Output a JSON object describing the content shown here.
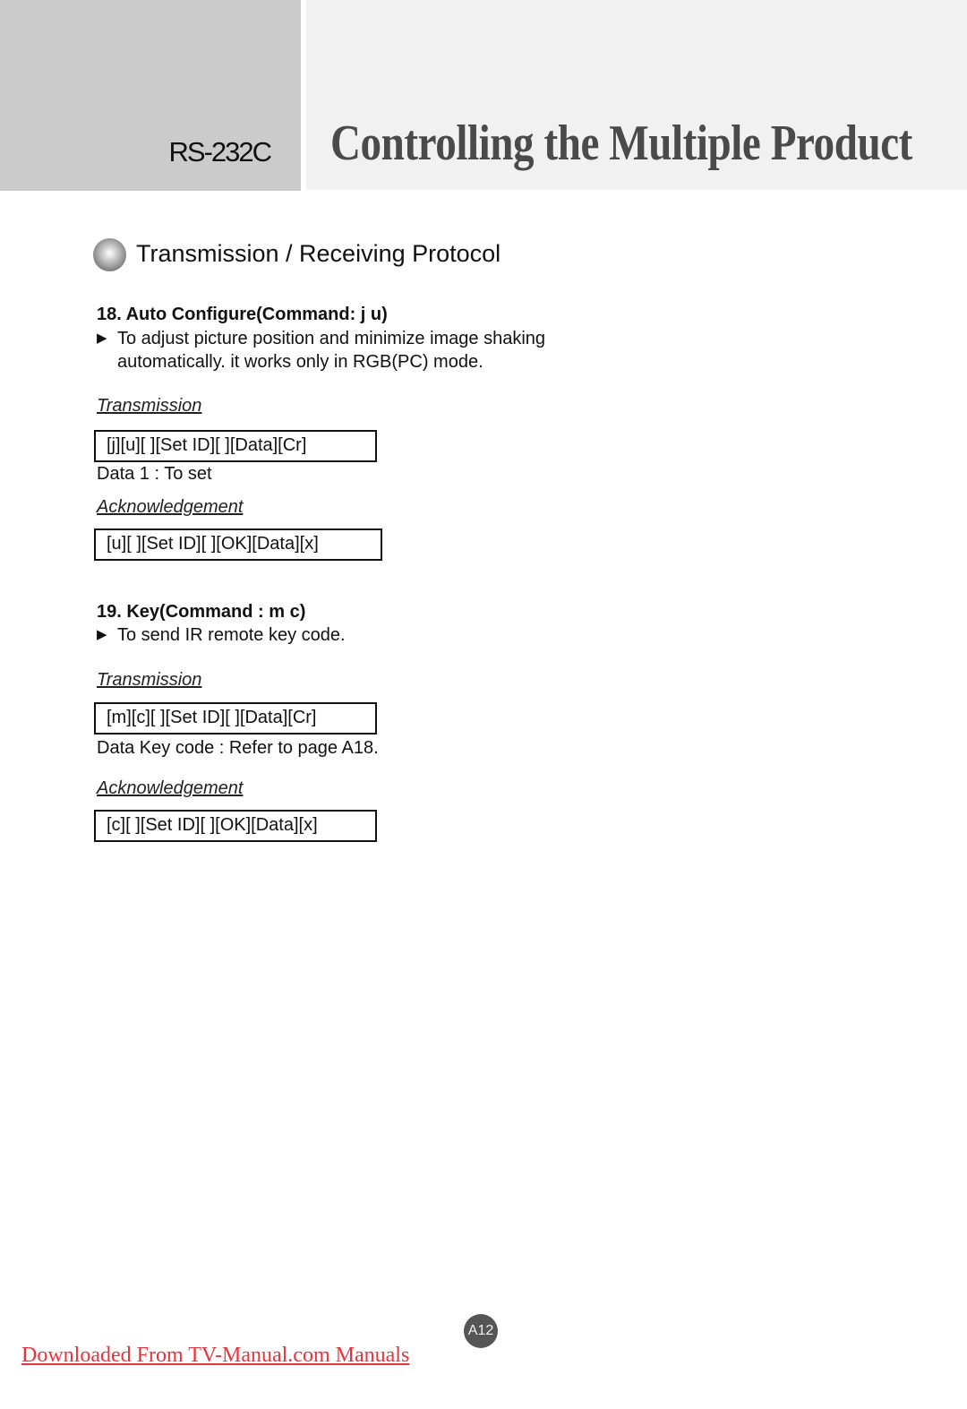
{
  "header": {
    "section_code": "RS-232C",
    "title": "Controlling the Multiple Product"
  },
  "section": {
    "icon": "sphere-bullet-icon",
    "title": "Transmission / Receiving Protocol"
  },
  "commands": [
    {
      "title": "18. Auto Configure(Command: j u)",
      "bullet": "▶",
      "description_line1": "To adjust picture position and minimize image shaking",
      "description_line2": "automatically. it works only in RGB(PC) mode.",
      "transmission_label": "Transmission",
      "transmission_code": "[j][u][ ][Set ID][ ][Data][Cr]",
      "data_note": "Data 1 : To set",
      "ack_label": "Acknowledgement",
      "ack_code": "[u][ ][Set ID][ ][OK][Data][x]"
    },
    {
      "title": "19. Key(Command : m c)",
      "bullet": "▶",
      "description_line1": "To send IR remote key code.",
      "transmission_label": "Transmission",
      "transmission_code": "[m][c][ ][Set ID][ ][Data][Cr]",
      "data_note": "Data  Key code : Refer to page A18.",
      "ack_label": "Acknowledgement",
      "ack_code": "[c][ ][Set ID][ ][OK][Data][x]"
    }
  ],
  "footer": {
    "page_number": "A12",
    "download_link": "Downloaded From TV-Manual.com Manuals",
    "link_color": "#e8323c"
  }
}
